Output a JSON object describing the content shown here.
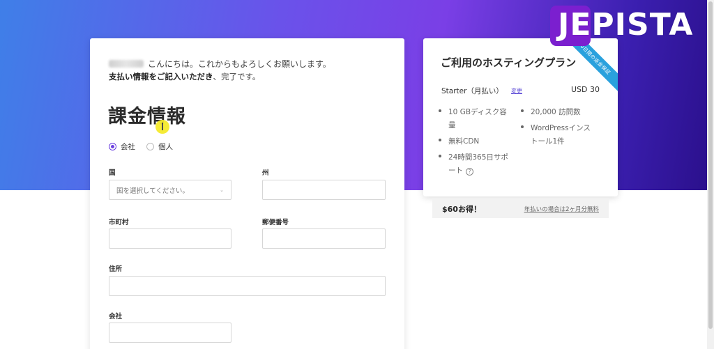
{
  "header": {
    "logo_text": "JEPISTA",
    "logo_color": "#7b1fcf",
    "gradient_colors": [
      "#3f7fe8",
      "#7a3fe6",
      "#2a0f8a"
    ]
  },
  "billing": {
    "greeting": "こんにちは。これからもよろしくお願いします。",
    "subline_bold": "支払い情報をご記入いただき",
    "subline_rest": "、完了です。",
    "title": "課金情報",
    "radio_options": [
      {
        "label": "会社",
        "checked": true
      },
      {
        "label": "個人",
        "checked": false
      }
    ],
    "fields": {
      "country": {
        "label": "国",
        "placeholder": "国を選択してください。"
      },
      "state": {
        "label": "州",
        "value": ""
      },
      "city": {
        "label": "市町村",
        "value": ""
      },
      "postal": {
        "label": "郵便番号",
        "value": ""
      },
      "address": {
        "label": "住所",
        "value": ""
      },
      "company": {
        "label": "会社",
        "value": ""
      }
    }
  },
  "plan": {
    "title": "ご利用のホスティングプラン",
    "ribbon": "30日間の返金保証",
    "name": "Starter（月払い）",
    "change_link": "変更",
    "price": "USD 30",
    "features_left": [
      {
        "lines": [
          "10 GBディスク容",
          "量"
        ]
      },
      {
        "lines": [
          "無料CDN"
        ]
      },
      {
        "lines": [
          "24時間365日サポ",
          "ート"
        ],
        "info": true
      }
    ],
    "features_right": [
      {
        "lines": [
          "20,000 訪問数"
        ]
      },
      {
        "lines": [
          "WordPressインス",
          "トール1件"
        ]
      }
    ],
    "accent_color": "#2aa1dd"
  },
  "savings": {
    "amount": "$60お得！",
    "note": "年払いの場合は2ヶ月分無料"
  }
}
